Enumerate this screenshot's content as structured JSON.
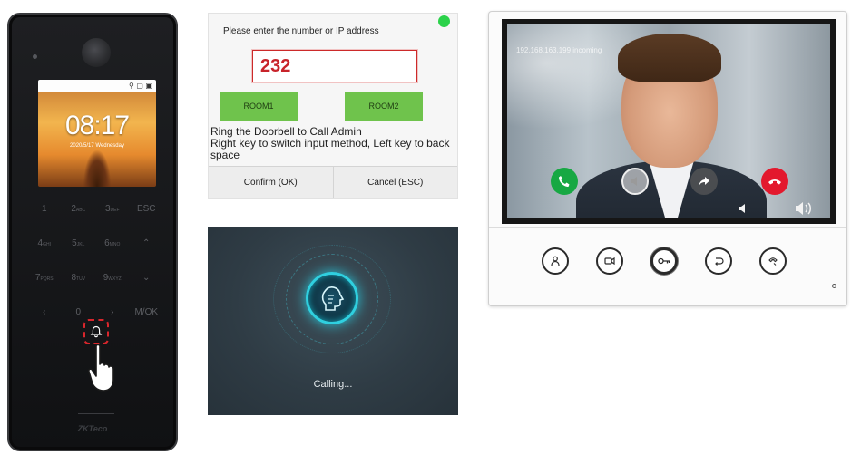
{
  "terminal": {
    "status_icons": "⚲ ▢ ▣",
    "time": "08:17",
    "date": "2020/5/17 Wednesday",
    "keys": [
      {
        "main": "1",
        "sub": ""
      },
      {
        "main": "2",
        "sub": "ABC"
      },
      {
        "main": "3",
        "sub": "DEF"
      },
      {
        "main": "ESC",
        "sub": ""
      },
      {
        "main": "4",
        "sub": "GHI"
      },
      {
        "main": "5",
        "sub": "JKL"
      },
      {
        "main": "6",
        "sub": "MNO"
      },
      {
        "main": "⌃",
        "sub": ""
      },
      {
        "main": "7",
        "sub": "PQRS"
      },
      {
        "main": "8",
        "sub": "TUV"
      },
      {
        "main": "9",
        "sub": "WXYZ"
      },
      {
        "main": "⌄",
        "sub": ""
      },
      {
        "main": "‹",
        "sub": ""
      },
      {
        "main": "0",
        "sub": ""
      },
      {
        "main": "›",
        "sub": ""
      },
      {
        "main": "M/OK",
        "sub": ""
      }
    ],
    "brand": "ZKTeco"
  },
  "dialog": {
    "prompt": "Please enter the number or IP address",
    "number_value": "232",
    "room1_label": "ROOM1",
    "room2_label": "ROOM2",
    "info_line1": "Ring the Doorbell to Call Admin",
    "info_line2": "Right key to switch input method, Left key to back space",
    "confirm_label": "Confirm (OK)",
    "cancel_label": "Cancel (ESC)"
  },
  "calling": {
    "text": "Calling..."
  },
  "monitor": {
    "incoming_info": "192.168.163.199 incoming"
  },
  "colors": {
    "accent_green": "#6fc34c",
    "status_green": "#2bd24a",
    "alert_red": "#d9262c",
    "answer_green": "#17a843",
    "hangup_red": "#e3182d",
    "ring_cyan": "#2fd0e0"
  }
}
